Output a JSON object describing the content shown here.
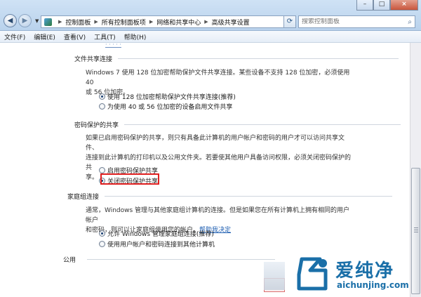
{
  "address_bar": {
    "segments": [
      "控制面板",
      "所有控制面板项",
      "网络和共享中心",
      "高级共享设置"
    ]
  },
  "search": {
    "placeholder": "搜索控制面板"
  },
  "window_controls": {
    "minimize": "–",
    "maximize": "□",
    "close": "×"
  },
  "menu": [
    "文件(F)",
    "编辑(E)",
    "查看(V)",
    "工具(T)",
    "帮助(H)"
  ],
  "sections": {
    "file_sharing": {
      "title": "文件共享连接",
      "desc_line1": "Windows 7 使用 128 位加密帮助保护文件共享连接。某些设备不支持 128 位加密，必须使用 40",
      "desc_line2": "或 56 位加密。",
      "options": [
        "使用 128 位加密帮助保护文件共享连接(推荐)",
        "为使用 40 或 56 位加密的设备启用文件共享"
      ],
      "selected": 0
    },
    "password_sharing": {
      "title": "密码保护的共享",
      "desc_line1": "如果已启用密码保护的共享，则只有具备此计算机的用户帐户和密码的用户才可以访问共享文件、",
      "desc_line2": "连接到此计算机的打印机以及公用文件夹。若要使其他用户具备访问权限，必须关闭密码保护的共",
      "desc_line3": "享。",
      "options": [
        "启用密码保护共享",
        "关闭密码保护共享"
      ],
      "selected": 1
    },
    "homegroup": {
      "title": "家庭组连接",
      "desc_line1": "通常，Windows 管理与其他家庭组计算机的连接。但是如果您在所有计算机上拥有相同的用户帐户",
      "desc_line2_prefix": "和密码，则可以让家庭组使用您的帐户。",
      "help_link": "帮助我决定",
      "options": [
        "允许 Windows 管理家庭组连接(推荐)",
        "使用用户帐户和密码连接到其他计算机"
      ],
      "selected": 0
    },
    "public": {
      "title": "公用"
    }
  },
  "watermark": {
    "name": "爱纯净",
    "url": "aichunjing.com"
  },
  "icons": {
    "back": "back-arrow-icon",
    "forward": "forward-arrow-icon",
    "refresh": "refresh-icon",
    "search": "search-icon",
    "control_panel": "control-panel-icon"
  },
  "colors": {
    "title_bar": "#c4dbf2",
    "link": "#1f5fb2",
    "highlight_box": "#e02020",
    "watermark": "#1a6fa8"
  }
}
